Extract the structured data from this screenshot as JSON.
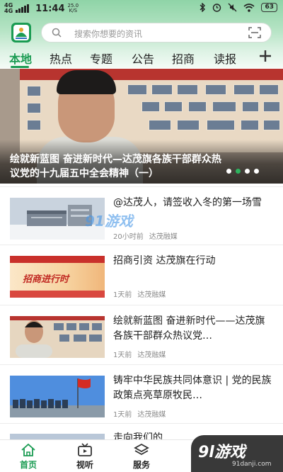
{
  "status_bar": {
    "signal1": "4G",
    "signal2": "4G",
    "time": "11:44",
    "net_speed_value": "25.0",
    "net_speed_unit": "K/S",
    "battery": "63"
  },
  "search": {
    "placeholder": "搜索你想要的资讯"
  },
  "tabs": [
    "本地",
    "热点",
    "专题",
    "公告",
    "招商",
    "读报"
  ],
  "active_tab": "本地",
  "banner": {
    "caption": "绘就新蓝图  奋进新时代—达茂旗各族干部群众热议党的十九届五中全会精神（一）",
    "dots": 4,
    "active_dot": 1
  },
  "news": [
    {
      "title": "@达茂人，请签收入冬的第一场雪",
      "time": "20小时前",
      "source": "达茂融媒",
      "thumb": "building-snow"
    },
    {
      "title": "招商引资  达茂旗在行动",
      "time": "1天前",
      "source": "达茂融媒",
      "thumb": "investment-banner",
      "thumb_text": "招商进行时"
    },
    {
      "title": "绘就新蓝图  奋进新时代——达茂旗各族干部群众热议党…",
      "time": "1天前",
      "source": "达茂融媒",
      "thumb": "man-interview"
    },
    {
      "title": "铸牢中华民族共同体意识  |  党的民族政策点亮草原牧民…",
      "time": "1天前",
      "source": "达茂融媒",
      "thumb": "flag-crowd"
    },
    {
      "title": "走向我们的…",
      "time": "",
      "source": "",
      "thumb": "partial"
    }
  ],
  "bottom_nav": [
    {
      "label": "首页",
      "icon": "home-icon",
      "active": true
    },
    {
      "label": "视听",
      "icon": "video-icon",
      "active": false
    },
    {
      "label": "服务",
      "icon": "layers-icon",
      "active": false
    }
  ],
  "watermarks": {
    "center": "91游戏",
    "corner_logo": "9l游戏",
    "corner_url": "91danji.com"
  },
  "colors": {
    "accent": "#1a9b52",
    "header_top": "#8fd4a7",
    "text": "#1f1f1f",
    "meta": "#8a8a8a"
  }
}
